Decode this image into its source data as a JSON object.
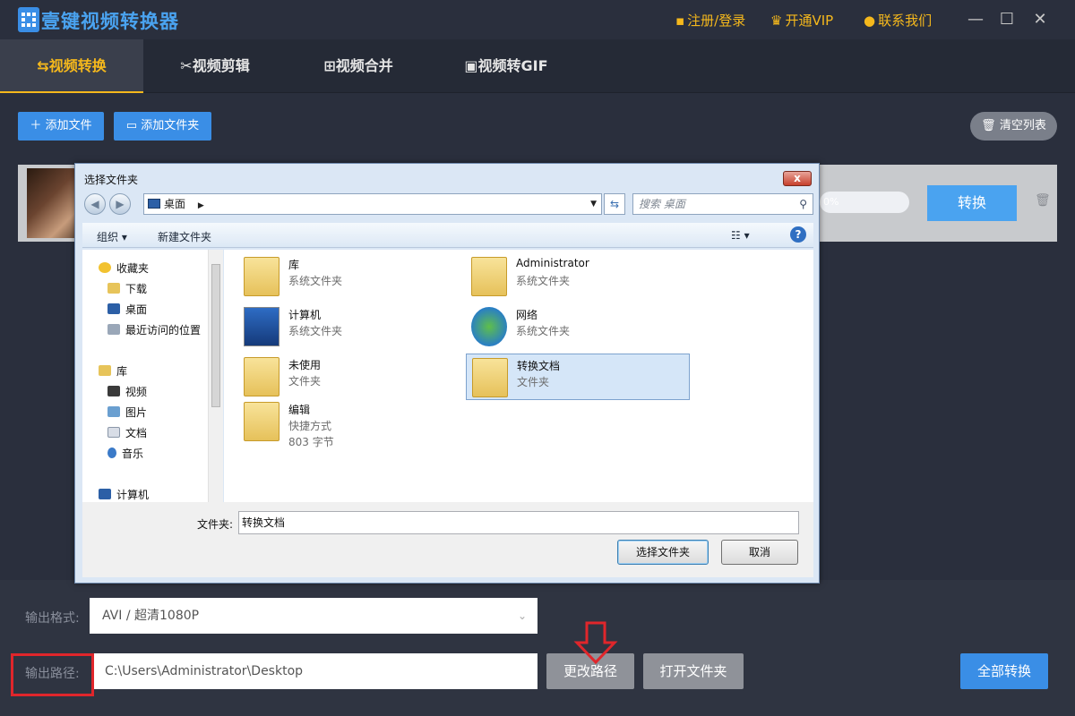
{
  "app": {
    "title": "壹键视频转换器",
    "links": {
      "register": "注册/登录",
      "vip": "开通VIP",
      "contact": "联系我们"
    },
    "colors": {
      "accent": "#f5b81c",
      "brand": "#3a8ee6",
      "background": "#2a2f3d"
    }
  },
  "tabs": [
    {
      "label": "视频转换",
      "icon": "convert-icon",
      "active": true
    },
    {
      "label": "视频剪辑",
      "icon": "cut-icon",
      "active": false
    },
    {
      "label": "视频合并",
      "icon": "merge-icon",
      "active": false
    },
    {
      "label": "视频转GIF",
      "icon": "gif-icon",
      "active": false
    }
  ],
  "toolbar": {
    "add_file": "添加文件",
    "add_folder": "添加文件夹",
    "clear_list": "清空列表"
  },
  "file_row": {
    "progress": "0%",
    "convert_label": "转换"
  },
  "bottom": {
    "format_label": "输出格式:",
    "format_value": "AVI / 超清1080P",
    "path_label": "输出路径:",
    "path_value": "C:\\Users\\Administrator\\Desktop",
    "change_path": "更改路径",
    "open_folder": "打开文件夹",
    "convert_all": "全部转换"
  },
  "dialog": {
    "title": "选择文件夹",
    "close": "x",
    "address": "桌面",
    "search_placeholder": "搜索 桌面",
    "organize": "组织 ▾",
    "new_folder": "新建文件夹",
    "tree": {
      "favorites": "收藏夹",
      "downloads": "下载",
      "desktop": "桌面",
      "recent": "最近访问的位置",
      "libraries": "库",
      "videos": "视频",
      "pictures": "图片",
      "documents": "文档",
      "music": "音乐",
      "computer": "计算机"
    },
    "items": [
      {
        "name": "库",
        "type": "系统文件夹"
      },
      {
        "name": "Administrator",
        "type": "系统文件夹"
      },
      {
        "name": "计算机",
        "type": "系统文件夹"
      },
      {
        "name": "网络",
        "type": "系统文件夹"
      },
      {
        "name": "未使用",
        "type": "文件夹"
      },
      {
        "name": "转换文档",
        "type": "文件夹"
      },
      {
        "name": "编辑",
        "type": "快捷方式",
        "size": "803 字节"
      }
    ],
    "folder_label": "文件夹:",
    "folder_value": "转换文档",
    "select_button": "选择文件夹",
    "cancel_button": "取消"
  }
}
